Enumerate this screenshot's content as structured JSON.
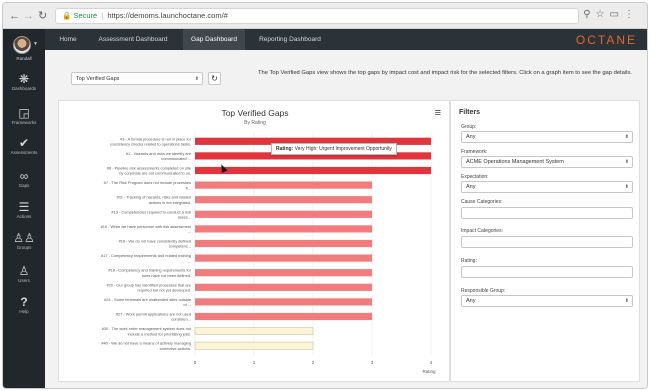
{
  "browser": {
    "secure_label": "Secure",
    "url": "https://demoms.launchoctane.com/#"
  },
  "sidebar": {
    "user_name": "Randall",
    "items": [
      {
        "label": "Dashboards",
        "icon": "palette-icon"
      },
      {
        "label": "Frameworks",
        "icon": "sitemap-icon"
      },
      {
        "label": "Assessments",
        "icon": "thumbs-up-icon"
      },
      {
        "label": "Gaps",
        "icon": "link-icon"
      },
      {
        "label": "Actions",
        "icon": "list-icon"
      },
      {
        "label": "Groups",
        "icon": "users-icon"
      },
      {
        "label": "Users",
        "icon": "user-icon"
      },
      {
        "label": "Help",
        "icon": "question-icon"
      }
    ]
  },
  "topnav": {
    "tabs": [
      "Home",
      "Assessment Dashboard",
      "Gap Dashboard",
      "Reporting Dashboard"
    ],
    "active_tab": "Gap Dashboard",
    "brand": "OCTANE"
  },
  "view_select": {
    "value": "Top Verified Gaps"
  },
  "description": "The Top Verified Gaps view shows the top gaps by impact cost and impact risk for the selected filters. Click on a graph item to see the gap details.",
  "tooltip": {
    "key": "Rating:",
    "value": "Very High: Urgent Improvement Opportunity"
  },
  "chart_data": {
    "type": "bar",
    "orientation": "horizontal",
    "title": "Top Verified Gaps",
    "subtitle": "By Rating",
    "xlabel": "Rating",
    "xlim": [
      0,
      4
    ],
    "xticks": [
      "0",
      "1",
      "2",
      "3",
      "4"
    ],
    "colors": {
      "very_high": "#e0353d",
      "high": "#f17c7e",
      "low": "#fbf5d6",
      "low_border": "#c9c39a"
    },
    "categories": [
      "#3 - A formal procedure is not in place for consistency checks related to operations tasks.",
      "#1 - Hazards and risks we identify are communicated ...",
      "#6 - Pipeline risk assessments completed on site by corporate are not communicated to us.",
      "#7 - The Risk Program does not include processes fr...",
      "#11 - Tracking of hazards, risks and related actions is not integrated.",
      "#13 - Competencies required to conduct a risk asses...",
      "#10 - While we have personnel with risk assessment ...",
      "#16 - We do not have consistently defined competenc...",
      "#17 - Competency requirements and related training ...",
      "#18 - Competency and training requirements for roles have not been defined.",
      "#20 - Our group has identified processes that are required but not yet developed.",
      "#24 - Some terminals are unattended sites outside of ...",
      "#27 - Work permit applications are not used consisten...",
      "#30 - The work order management system does not include a method for prioritizing jobs.",
      "#40 - We do not have a means of actively managing corrective actions."
    ],
    "values": [
      4,
      4,
      4,
      3,
      3,
      3,
      3,
      3,
      3,
      3,
      3,
      3,
      3,
      2,
      2
    ],
    "levels": [
      "very_high",
      "very_high",
      "very_high",
      "high",
      "high",
      "high",
      "high",
      "high",
      "high",
      "high",
      "high",
      "high",
      "high",
      "low",
      "low"
    ]
  },
  "filters": {
    "title": "Filters",
    "group": {
      "label": "Group:",
      "value": "Any"
    },
    "framework": {
      "label": "Framework:",
      "value": "ACME Operations Management System"
    },
    "expectation": {
      "label": "Expectation:",
      "value": "Any"
    },
    "cause_categories": {
      "label": "Cause Categories:",
      "value": ""
    },
    "impact_categories": {
      "label": "Impact Categories:",
      "value": ""
    },
    "rating": {
      "label": "Rating:",
      "value": ""
    },
    "responsible_group": {
      "label": "Responsible Group:",
      "value": "Any"
    }
  }
}
